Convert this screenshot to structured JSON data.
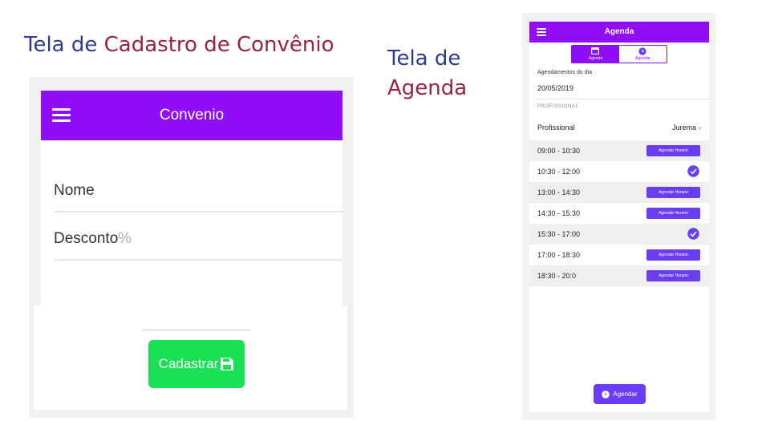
{
  "captions": {
    "convenio_prefix": "Tela de ",
    "convenio_name": "Cadastro de Convênio",
    "agenda_line1": "Tela de",
    "agenda_line2": "Agenda"
  },
  "colors": {
    "header_purple": "#8f0ef7",
    "button_green": "#18e155",
    "button_violet": "#6a3cf2",
    "caption_blue": "#2f3b8f",
    "caption_red": "#9b2340"
  },
  "convenio": {
    "title": "Convenio",
    "menu_icon": "hamburger-menu-icon",
    "fields": [
      {
        "label": "Nome",
        "suffix": ""
      },
      {
        "label": "Desconto",
        "suffix": "%"
      }
    ],
    "submit_label": "Cadastrar",
    "submit_icon": "save-icon"
  },
  "agenda": {
    "title": "Agenda",
    "menu_icon": "hamburger-menu-icon",
    "tabs": [
      {
        "label": "Agenda",
        "icon": "calendar-icon",
        "active": true
      },
      {
        "label": "Agendar",
        "icon": "clock-icon",
        "active": false
      }
    ],
    "day_label": "Agendamentos do dia",
    "date": "20/05/2019",
    "section_header": "PROFISSIONAL",
    "professional_label": "Profissional",
    "professional_value": "Jurema",
    "slots": [
      {
        "time": "09:00 - 10:30",
        "action": "Agendar Horario",
        "booked": false
      },
      {
        "time": "10:30 - 12:00",
        "action": "",
        "booked": true
      },
      {
        "time": "13:00 - 14:30",
        "action": "Agendar Horario",
        "booked": false
      },
      {
        "time": "14:30 - 15:30",
        "action": "Agendar Horario",
        "booked": false
      },
      {
        "time": "15:30 - 17:00",
        "action": "",
        "booked": true
      },
      {
        "time": "17:00 - 18:30",
        "action": "Agendar Horario",
        "booked": false
      },
      {
        "time": "18:30 - 20:0",
        "action": "Agendar Horario",
        "booked": false
      }
    ],
    "fab_label": "Agendar",
    "fab_icon": "clock-icon"
  }
}
